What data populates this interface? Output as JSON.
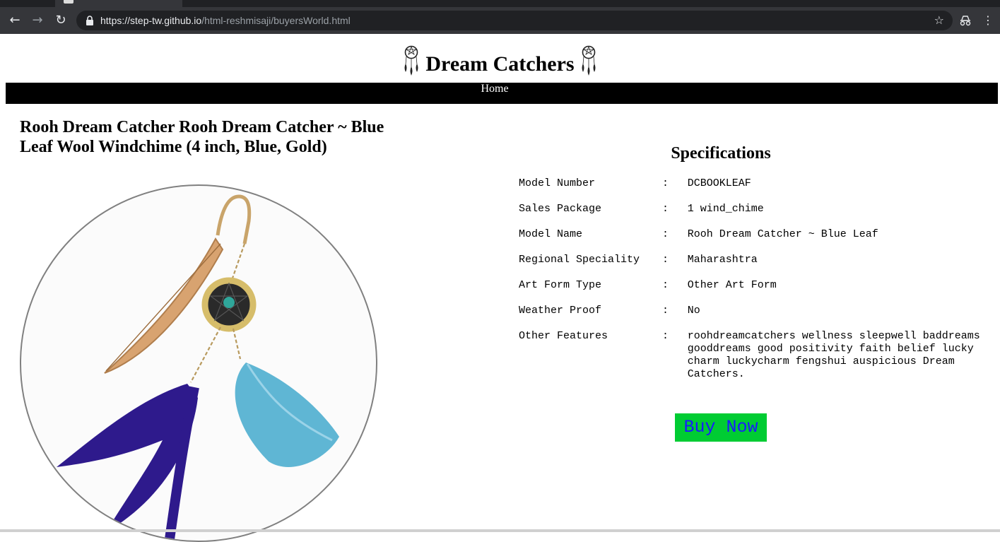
{
  "browser": {
    "url_host": "https://step-tw.github.io",
    "url_path": "/html-reshmisaji/buyersWorld.html",
    "icons": [
      "back-arrow-icon",
      "forward-arrow-icon",
      "reload-icon",
      "lock-icon",
      "star-icon",
      "extension-icon",
      "menu-icon"
    ]
  },
  "header": {
    "title": "Dream Catchers",
    "logo_icon": "dreamcatcher-icon"
  },
  "nav": {
    "home_label": "Home"
  },
  "product": {
    "title": "Rooh Dream Catcher Rooh Dream Catcher ~ Blue Leaf Wool Windchime (4 inch, Blue, Gold)"
  },
  "specs": {
    "heading": "Specifications",
    "separator": ":",
    "rows": [
      {
        "label": "Model Number",
        "value": "DCBOOKLEAF"
      },
      {
        "label": "Sales Package",
        "value": "1 wind_chime"
      },
      {
        "label": "Model Name",
        "value": "Rooh Dream Catcher ~ Blue Leaf"
      },
      {
        "label": "Regional Speciality",
        "value": "Maharashtra"
      },
      {
        "label": "Art Form Type",
        "value": "Other Art Form"
      },
      {
        "label": "Weather Proof",
        "value": "No"
      },
      {
        "label": "Other Features",
        "value": "roohdreamcatchers wellness sleepwell baddreams gooddreams good positivity faith belief lucky charm luckycharm fengshui auspicious Dream Catchers."
      }
    ]
  },
  "buy": {
    "label": "Buy Now"
  },
  "colors": {
    "buy_bg": "#00cc33",
    "buy_text": "#1a1aff",
    "navbar_bg": "#000000"
  }
}
